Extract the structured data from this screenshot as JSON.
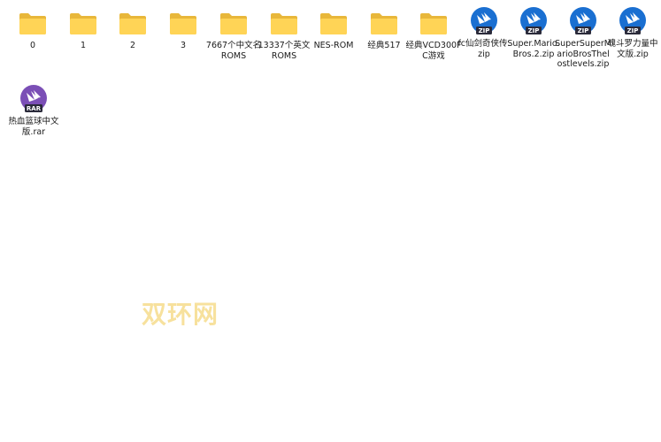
{
  "items": [
    {
      "name": "0",
      "icon": "folder-icon"
    },
    {
      "name": "1",
      "icon": "folder-icon"
    },
    {
      "name": "2",
      "icon": "folder-icon"
    },
    {
      "name": "3",
      "icon": "folder-icon"
    },
    {
      "name": "7667个中文名ROMS",
      "icon": "folder-icon"
    },
    {
      "name": "13337个英文ROMS",
      "icon": "folder-icon"
    },
    {
      "name": "NES-ROM",
      "icon": "folder-icon"
    },
    {
      "name": "经典517",
      "icon": "folder-icon"
    },
    {
      "name": "经典VCD300FC游戏",
      "icon": "folder-icon"
    },
    {
      "name": "fc仙剑奇侠传.zip",
      "icon": "zip-archive-icon"
    },
    {
      "name": "Super.Mario.Bros.2.zip",
      "icon": "zip-archive-icon"
    },
    {
      "name": "SuperSuperMarioBrosThelostlevels.zip",
      "icon": "zip-archive-icon"
    },
    {
      "name": "魂斗罗力量中文版.zip",
      "icon": "zip-archive-icon"
    },
    {
      "name": "热血篮球中文版.rar",
      "icon": "rar-archive-icon"
    }
  ],
  "badges": {
    "zip": "ZIP",
    "rar": "RAR"
  },
  "watermark": "双环网",
  "colors": {
    "folder_back": "#e8b73a",
    "folder_front": "#ffd456",
    "folder_contents": "#2b2b2b",
    "zip_circle": "#1a6fd1",
    "rar_circle": "#7b4fb6",
    "badge_bg": "#2a2a3a",
    "watermark": "#f6dc8c"
  }
}
